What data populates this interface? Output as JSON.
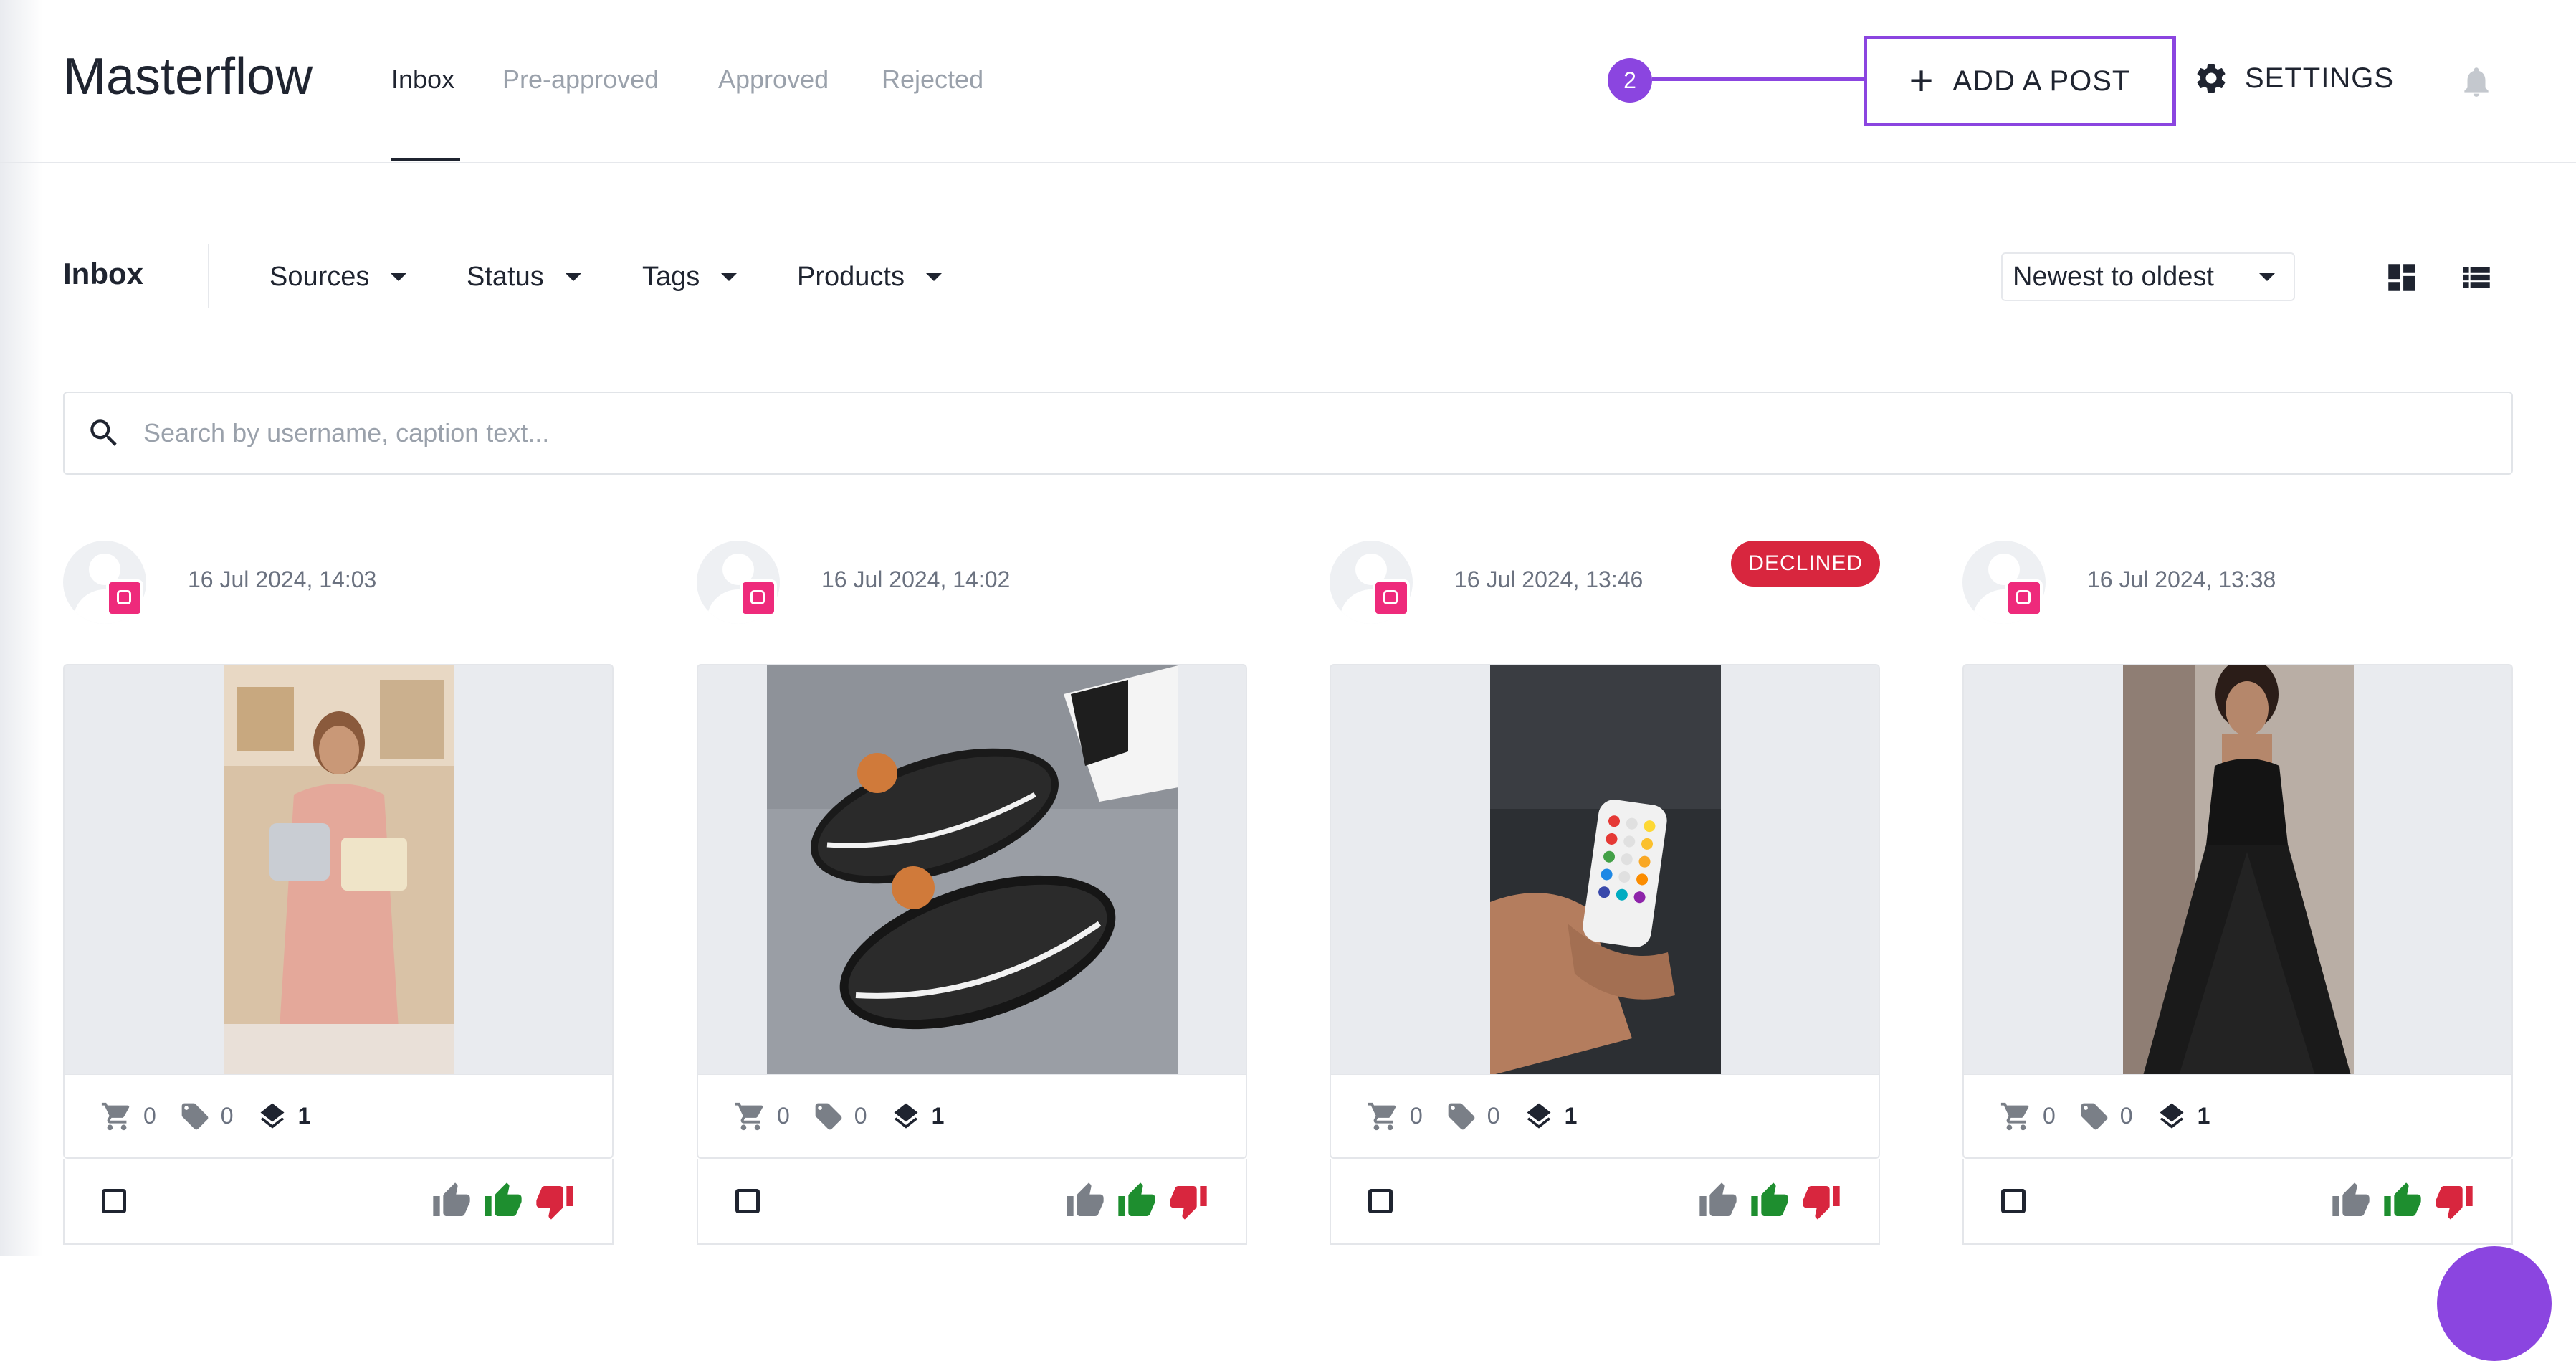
{
  "app": {
    "brand": "Masterflow"
  },
  "nav": {
    "tabs": [
      {
        "label": "Inbox",
        "active": true
      },
      {
        "label": "Pre-approved",
        "active": false
      },
      {
        "label": "Approved",
        "active": false
      },
      {
        "label": "Rejected",
        "active": false
      }
    ]
  },
  "header": {
    "add_post_label": "ADD A POST",
    "settings_label": "SETTINGS",
    "step_marker": "2",
    "highlight_color": "#8b45e0"
  },
  "filters": {
    "section_title": "Inbox",
    "items": [
      "Sources",
      "Status",
      "Tags",
      "Products"
    ],
    "sort_value": "Newest to oldest"
  },
  "search": {
    "placeholder": "Search by username, caption text...",
    "value": ""
  },
  "cards": [
    {
      "date": "16 Jul 2024, 14:03",
      "source": "instagram-icon",
      "status": "",
      "products": "0",
      "tags": "0",
      "layers": "1",
      "media": "woman holding handbags in boutique"
    },
    {
      "date": "16 Jul 2024, 14:02",
      "source": "instagram-icon",
      "status": "",
      "products": "0",
      "tags": "0",
      "layers": "1",
      "media": "black slide sandals on grey surface"
    },
    {
      "date": "16 Jul 2024, 13:46",
      "source": "instagram-icon",
      "status": "DECLINED",
      "products": "0",
      "tags": "0",
      "layers": "1",
      "media": "hand holding LED remote control"
    },
    {
      "date": "16 Jul 2024, 13:38",
      "source": "instagram-icon",
      "status": "",
      "products": "0",
      "tags": "0",
      "layers": "1",
      "media": "woman in black evening gown"
    }
  ],
  "colors": {
    "declined": "#d8263e",
    "approve": "#1e8e2f",
    "reject": "#d8263e",
    "neutral": "#7a7f87"
  }
}
